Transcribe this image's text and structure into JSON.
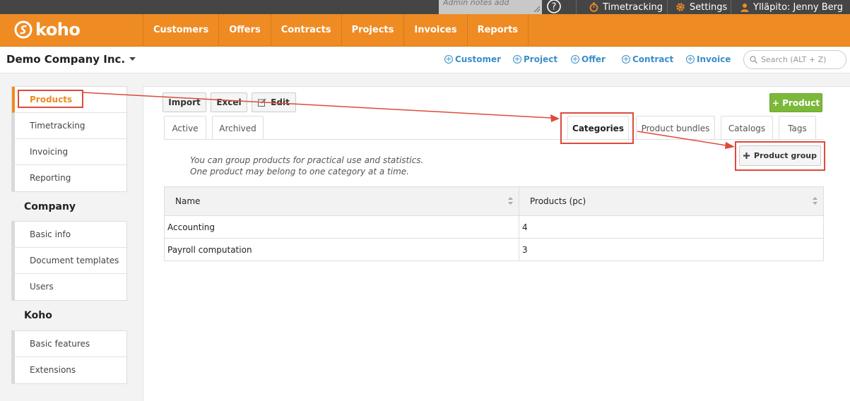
{
  "topbar": {
    "admin_notes_placeholder": "Admin notes add",
    "help_symbol": "?",
    "timetracking": "Timetracking",
    "settings": "Settings",
    "user": "Ylläpito: Jenny Berg"
  },
  "brand": {
    "logo_text": "koho",
    "accent": "#ef8b23"
  },
  "nav": {
    "items": [
      "Customers",
      "Offers",
      "Contracts",
      "Projects",
      "Invoices",
      "Reports"
    ]
  },
  "subheader": {
    "company": "Demo Company Inc.",
    "quick_actions": [
      "Customer",
      "Project",
      "Offer",
      "Contract",
      "Invoice"
    ],
    "search_placeholder": "Search (ALT + Z)"
  },
  "sidebar": {
    "group1": [
      "Products",
      "Timetracking",
      "Invoicing",
      "Reporting"
    ],
    "company_heading": "Company",
    "group2": [
      "Basic info",
      "Document templates",
      "Users"
    ],
    "koho_heading": "Koho",
    "group3": [
      "Basic features",
      "Extensions"
    ]
  },
  "toolbar": {
    "import": "Import",
    "excel": "Excel",
    "edit": "Edit",
    "add_product": "+ Product"
  },
  "tabs": {
    "active": "Active",
    "archived": "Archived",
    "categories": "Categories",
    "product_bundles": "Product bundles",
    "catalogs": "Catalogs",
    "tags": "Tags"
  },
  "categories": {
    "info_line1": "You can group products for practical use and statistics.",
    "info_line2": "One product may belong to one category at a time.",
    "add_group": "Product group",
    "columns": [
      "Name",
      "Products (pc)"
    ],
    "rows": [
      {
        "name": "Accounting",
        "count": "4"
      },
      {
        "name": "Payroll computation",
        "count": "3"
      }
    ]
  },
  "colors": {
    "annotation": "#dd4a3a",
    "green": "#7cb83a",
    "link": "#3a8fc7"
  }
}
